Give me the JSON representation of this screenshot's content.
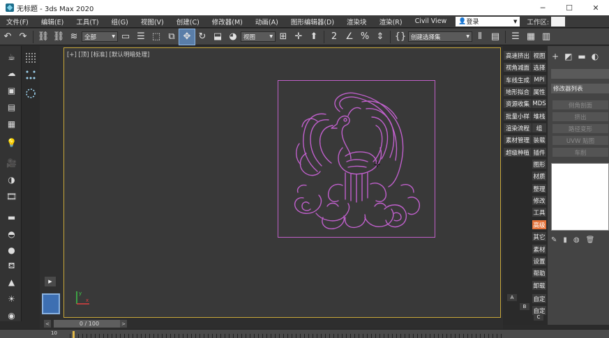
{
  "window": {
    "title": "无标题 - 3ds Max 2020",
    "controls": [
      "─",
      "☐",
      "✕"
    ]
  },
  "menu": {
    "items": [
      "文件(F)",
      "编辑(E)",
      "工具(T)",
      "组(G)",
      "视图(V)",
      "创建(C)",
      "修改器(M)",
      "动画(A)",
      "图形编辑器(D)",
      "渲染块",
      "渲染(R)",
      "Civil View"
    ],
    "login_label": "登录",
    "workspace_label": "工作区:"
  },
  "toolbar": {
    "selection_filter": "全部",
    "reference_coord": "视图",
    "named_selection": "创建选择集"
  },
  "viewport": {
    "label": "[+] [顶] [标准] [默认明暗处理]",
    "frame_color": "#c160c9",
    "border_color": "#c9a83a"
  },
  "command_buttons": {
    "col1": [
      "高速挤出",
      "视角减面",
      "车线生成",
      "地形拟合",
      "资源收集",
      "批量小样",
      "渲染流程",
      "素材管理",
      "超级种植"
    ],
    "col2": [
      "视图",
      "选择",
      "MPI",
      "属性",
      "MDS",
      "堆栈",
      "组",
      "装载",
      "插件",
      "图形",
      "材质",
      "整理",
      "修改",
      "工具",
      "高级",
      "其它",
      "素材",
      "设置",
      "帮助",
      "卸载",
      "自定",
      "自定"
    ],
    "highlighted": "高级",
    "abc": [
      "A",
      "B",
      "C"
    ]
  },
  "modifier_panel": {
    "list_label": "修改器列表",
    "buttons": [
      "倒角剖面",
      "挤出",
      "路径变形",
      "UVW 贴图",
      "车削"
    ]
  },
  "timeline": {
    "position": "0 / 100",
    "prev": "<",
    "next": ">",
    "tick_start": "10"
  },
  "icons": {
    "left_strip": [
      "teapot-icon",
      "cloud-icon",
      "render-frame-icon",
      "layer-list-icon",
      "table-icon",
      "light-bulb-icon",
      "camera-icon",
      "sound-icon",
      "film-icon",
      "box-icon",
      "dome-icon",
      "sphere-icon",
      "pot-icon",
      "cone-icon",
      "sun-icon",
      "disc-icon"
    ]
  }
}
